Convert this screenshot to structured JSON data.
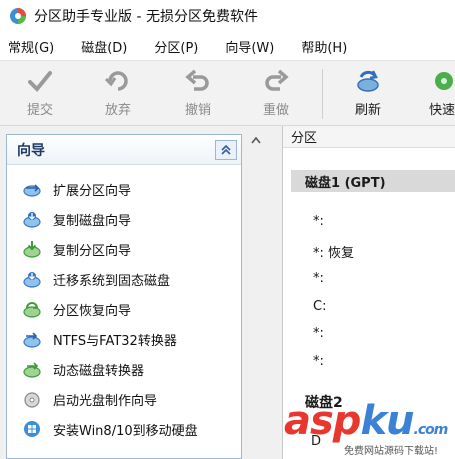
{
  "window": {
    "title": "分区助手专业版 - 无损分区免费软件"
  },
  "menu": [
    {
      "label": "常规(G)"
    },
    {
      "label": "磁盘(D)"
    },
    {
      "label": "分区(P)"
    },
    {
      "label": "向导(W)"
    },
    {
      "label": "帮助(H)"
    }
  ],
  "toolbar": {
    "submit": "提交",
    "discard": "放弃",
    "undo": "撤销",
    "redo": "重做",
    "refresh": "刷新",
    "quick": "快速"
  },
  "wizard_panel": {
    "title": "向导",
    "items": [
      {
        "label": "扩展分区向导",
        "icon": "extend-partition-icon"
      },
      {
        "label": "复制磁盘向导",
        "icon": "copy-disk-icon"
      },
      {
        "label": "复制分区向导",
        "icon": "copy-partition-icon"
      },
      {
        "label": "迁移系统到固态磁盘",
        "icon": "migrate-os-icon"
      },
      {
        "label": "分区恢复向导",
        "icon": "partition-recovery-icon"
      },
      {
        "label": "NTFS与FAT32转换器",
        "icon": "ntfs-fat32-converter-icon"
      },
      {
        "label": "动态磁盘转换器",
        "icon": "dynamic-disk-converter-icon"
      },
      {
        "label": "启动光盘制作向导",
        "icon": "bootable-cd-icon"
      },
      {
        "label": "安装Win8/10到移动硬盘",
        "icon": "windows-to-go-icon"
      }
    ]
  },
  "partition_view": {
    "header": "分区",
    "disk1": "磁盘1 (GPT)",
    "rows": [
      "*:",
      "*: 恢复",
      "*:",
      "C:",
      "*:",
      "*:"
    ],
    "disk2": "磁盘2",
    "disk2_row": "D"
  },
  "watermark": {
    "brand_a": "asp",
    "brand_b": "ku",
    "suffix": ".com",
    "tagline": "免费网站源码下载站!"
  }
}
